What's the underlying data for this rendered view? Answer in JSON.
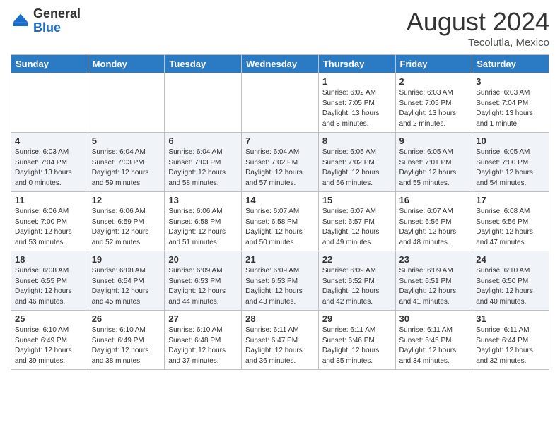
{
  "header": {
    "logo_general": "General",
    "logo_blue": "Blue",
    "month_year": "August 2024",
    "location": "Tecolutla, Mexico"
  },
  "weekdays": [
    "Sunday",
    "Monday",
    "Tuesday",
    "Wednesday",
    "Thursday",
    "Friday",
    "Saturday"
  ],
  "weeks": [
    [
      {
        "day": "",
        "info": ""
      },
      {
        "day": "",
        "info": ""
      },
      {
        "day": "",
        "info": ""
      },
      {
        "day": "",
        "info": ""
      },
      {
        "day": "1",
        "info": "Sunrise: 6:02 AM\nSunset: 7:05 PM\nDaylight: 13 hours\nand 3 minutes."
      },
      {
        "day": "2",
        "info": "Sunrise: 6:03 AM\nSunset: 7:05 PM\nDaylight: 13 hours\nand 2 minutes."
      },
      {
        "day": "3",
        "info": "Sunrise: 6:03 AM\nSunset: 7:04 PM\nDaylight: 13 hours\nand 1 minute."
      }
    ],
    [
      {
        "day": "4",
        "info": "Sunrise: 6:03 AM\nSunset: 7:04 PM\nDaylight: 13 hours\nand 0 minutes."
      },
      {
        "day": "5",
        "info": "Sunrise: 6:04 AM\nSunset: 7:03 PM\nDaylight: 12 hours\nand 59 minutes."
      },
      {
        "day": "6",
        "info": "Sunrise: 6:04 AM\nSunset: 7:03 PM\nDaylight: 12 hours\nand 58 minutes."
      },
      {
        "day": "7",
        "info": "Sunrise: 6:04 AM\nSunset: 7:02 PM\nDaylight: 12 hours\nand 57 minutes."
      },
      {
        "day": "8",
        "info": "Sunrise: 6:05 AM\nSunset: 7:02 PM\nDaylight: 12 hours\nand 56 minutes."
      },
      {
        "day": "9",
        "info": "Sunrise: 6:05 AM\nSunset: 7:01 PM\nDaylight: 12 hours\nand 55 minutes."
      },
      {
        "day": "10",
        "info": "Sunrise: 6:05 AM\nSunset: 7:00 PM\nDaylight: 12 hours\nand 54 minutes."
      }
    ],
    [
      {
        "day": "11",
        "info": "Sunrise: 6:06 AM\nSunset: 7:00 PM\nDaylight: 12 hours\nand 53 minutes."
      },
      {
        "day": "12",
        "info": "Sunrise: 6:06 AM\nSunset: 6:59 PM\nDaylight: 12 hours\nand 52 minutes."
      },
      {
        "day": "13",
        "info": "Sunrise: 6:06 AM\nSunset: 6:58 PM\nDaylight: 12 hours\nand 51 minutes."
      },
      {
        "day": "14",
        "info": "Sunrise: 6:07 AM\nSunset: 6:58 PM\nDaylight: 12 hours\nand 50 minutes."
      },
      {
        "day": "15",
        "info": "Sunrise: 6:07 AM\nSunset: 6:57 PM\nDaylight: 12 hours\nand 49 minutes."
      },
      {
        "day": "16",
        "info": "Sunrise: 6:07 AM\nSunset: 6:56 PM\nDaylight: 12 hours\nand 48 minutes."
      },
      {
        "day": "17",
        "info": "Sunrise: 6:08 AM\nSunset: 6:56 PM\nDaylight: 12 hours\nand 47 minutes."
      }
    ],
    [
      {
        "day": "18",
        "info": "Sunrise: 6:08 AM\nSunset: 6:55 PM\nDaylight: 12 hours\nand 46 minutes."
      },
      {
        "day": "19",
        "info": "Sunrise: 6:08 AM\nSunset: 6:54 PM\nDaylight: 12 hours\nand 45 minutes."
      },
      {
        "day": "20",
        "info": "Sunrise: 6:09 AM\nSunset: 6:53 PM\nDaylight: 12 hours\nand 44 minutes."
      },
      {
        "day": "21",
        "info": "Sunrise: 6:09 AM\nSunset: 6:53 PM\nDaylight: 12 hours\nand 43 minutes."
      },
      {
        "day": "22",
        "info": "Sunrise: 6:09 AM\nSunset: 6:52 PM\nDaylight: 12 hours\nand 42 minutes."
      },
      {
        "day": "23",
        "info": "Sunrise: 6:09 AM\nSunset: 6:51 PM\nDaylight: 12 hours\nand 41 minutes."
      },
      {
        "day": "24",
        "info": "Sunrise: 6:10 AM\nSunset: 6:50 PM\nDaylight: 12 hours\nand 40 minutes."
      }
    ],
    [
      {
        "day": "25",
        "info": "Sunrise: 6:10 AM\nSunset: 6:49 PM\nDaylight: 12 hours\nand 39 minutes."
      },
      {
        "day": "26",
        "info": "Sunrise: 6:10 AM\nSunset: 6:49 PM\nDaylight: 12 hours\nand 38 minutes."
      },
      {
        "day": "27",
        "info": "Sunrise: 6:10 AM\nSunset: 6:48 PM\nDaylight: 12 hours\nand 37 minutes."
      },
      {
        "day": "28",
        "info": "Sunrise: 6:11 AM\nSunset: 6:47 PM\nDaylight: 12 hours\nand 36 minutes."
      },
      {
        "day": "29",
        "info": "Sunrise: 6:11 AM\nSunset: 6:46 PM\nDaylight: 12 hours\nand 35 minutes."
      },
      {
        "day": "30",
        "info": "Sunrise: 6:11 AM\nSunset: 6:45 PM\nDaylight: 12 hours\nand 34 minutes."
      },
      {
        "day": "31",
        "info": "Sunrise: 6:11 AM\nSunset: 6:44 PM\nDaylight: 12 hours\nand 32 minutes."
      }
    ]
  ]
}
